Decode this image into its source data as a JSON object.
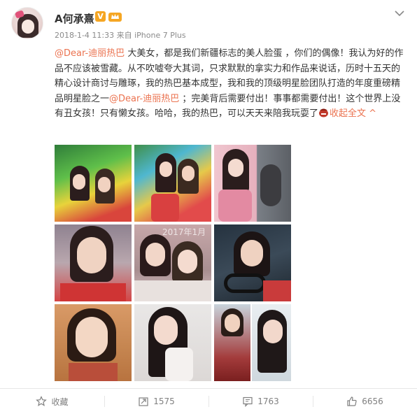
{
  "user": {
    "name": "A何承熹",
    "verified_badge": "V",
    "meta": "2018-1-4 11:33 来自 iPhone 7 Plus"
  },
  "post": {
    "mention_1": "@Dear-迪丽热巴",
    "text_1": " 大美女，都是我们新疆标志的美人脸蛋 ，你们的偶像！我认为好的作品不应该被雪藏。从不吹嘘夸大其词，只求默默的拿实力和作品来说话，历时十五天的精心设计商讨与雕琢，我的热巴基本成型，我和我的顶级明星脸团队打造的年度重磅精品明星脸之一",
    "mention_2": "@Dear-迪丽热巴",
    "text_2": " ；完美背后需要付出！事事都需要付出！这个世界上没有丑女孩！只有懒女孩。哈哈，我的热巴，可以天天来陪我玩耍了",
    "collapse_label": "收起全文",
    "collapse_arrow": "^"
  },
  "photos": {
    "watermark_5": "2017年1月"
  },
  "actions": {
    "favorite_label": "收藏",
    "repost_count": "1575",
    "comment_count": "1763",
    "like_count": "6656"
  },
  "icons": {
    "avatar": "avatar-girl",
    "level": "crown-icon",
    "menu": "chevron-down-icon",
    "favorite": "star-icon",
    "repost": "repost-icon",
    "comment": "comment-icon",
    "like": "thumbs-up-icon"
  },
  "colors": {
    "accent": "#eb7350",
    "verified": "#f5a623",
    "muted_text": "#808080"
  }
}
